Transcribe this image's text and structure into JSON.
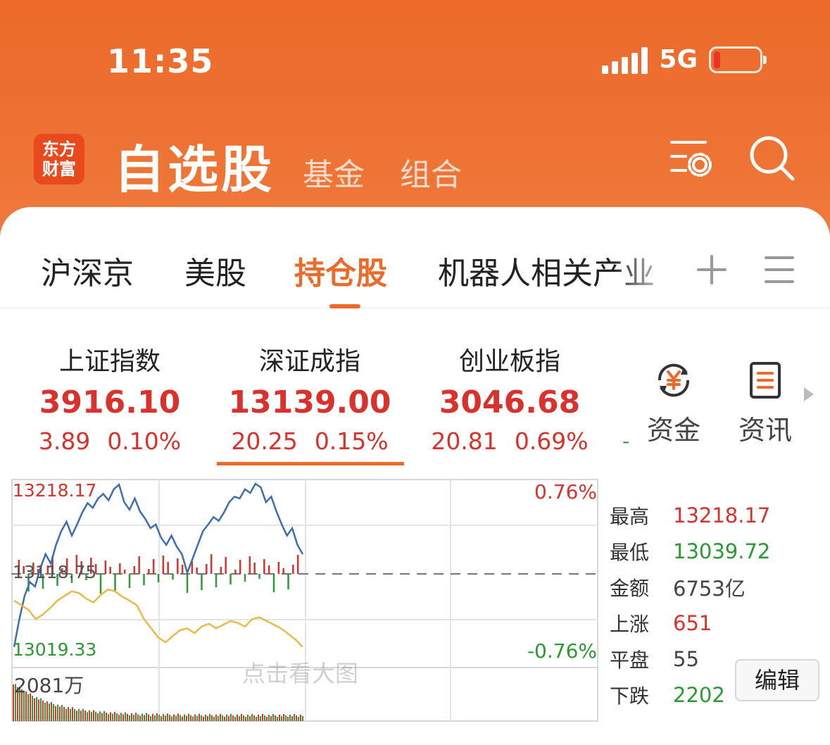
{
  "status_bar": {
    "time": "11:35",
    "network": "5G"
  },
  "header": {
    "logo_line1": "东方",
    "logo_line2": "财富",
    "title": "自选股",
    "tabs": [
      "基金",
      "组合"
    ],
    "icons": [
      "settings-list-icon",
      "search-icon"
    ]
  },
  "sub_tabs": {
    "items": [
      "沪深京",
      "美股",
      "持仓股",
      "机器人相关产业"
    ],
    "active": "持仓股",
    "icons": [
      "plus-icon",
      "menu-icon"
    ]
  },
  "indices": [
    {
      "name": "上证指数",
      "value": "3916.10",
      "change": "3.89",
      "pct": "0.10%"
    },
    {
      "name": "深证成指",
      "value": "13139.00",
      "change": "20.25",
      "pct": "0.15%"
    },
    {
      "name": "创业板指",
      "value": "3046.68",
      "change": "20.81",
      "pct": "0.69%"
    }
  ],
  "indices_overflow_mark": "-",
  "tools": [
    {
      "label": "资金",
      "icon": "yuan-flow-icon"
    },
    {
      "label": "资讯",
      "icon": "news-doc-icon"
    }
  ],
  "chart": {
    "high_label": "13218.17",
    "base_label": "13118.75",
    "low_label": "13019.33",
    "pct_high": "0.76%",
    "pct_low": "-0.76%",
    "volume_label": "2081万",
    "watermark": "点击看大图"
  },
  "stats": [
    {
      "label": "最高",
      "value": "13218.17",
      "color": "red"
    },
    {
      "label": "最低",
      "value": "13039.72",
      "color": "green"
    },
    {
      "label": "金额",
      "value": "6753亿",
      "color": "grey"
    },
    {
      "label": "上涨",
      "value": "651",
      "color": "red"
    },
    {
      "label": "平盘",
      "value": "55",
      "color": "grey"
    },
    {
      "label": "下跌",
      "value": "2202",
      "color": "green"
    }
  ],
  "edit_button": "编辑",
  "colors": {
    "accent": "#ec6a2a",
    "up": "#d9312b",
    "down": "#2b9a33",
    "price_line": "#3d6db5",
    "avg_line": "#eab949"
  },
  "chart_data": {
    "type": "line",
    "ylim": [
      13019.33,
      13218.17
    ],
    "reference": 13118.75,
    "series": [
      {
        "values": [
          13040,
          13070,
          13095,
          13110,
          13105,
          13125,
          13140,
          13130,
          13150,
          13165,
          13175,
          13160,
          13172,
          13185,
          13195,
          13190,
          13200,
          13205,
          13198,
          13210,
          13215,
          13196,
          13188,
          13200,
          13186,
          13178,
          13168,
          13172,
          13158,
          13150,
          13160,
          13148,
          13140,
          13120,
          13135,
          13150,
          13165,
          13172,
          13180,
          13176,
          13185,
          13196,
          13202,
          13200,
          13210,
          13206,
          13216,
          13212,
          13196,
          13202,
          13186,
          13172,
          13160,
          13168,
          13150,
          13140
        ]
      },
      {
        "values": [
          13090,
          13085,
          13080,
          13070,
          13075,
          13082,
          13090,
          13095,
          13100,
          13098,
          13092,
          13088,
          13096,
          13102,
          13100,
          13094,
          13090,
          13085,
          13070,
          13060,
          13050,
          13045,
          13052,
          13058,
          13060,
          13055,
          13062,
          13065,
          13060,
          13064,
          13068,
          13066,
          13062,
          13070,
          13072,
          13068,
          13064,
          13060,
          13054,
          13048,
          13040
        ]
      }
    ]
  }
}
